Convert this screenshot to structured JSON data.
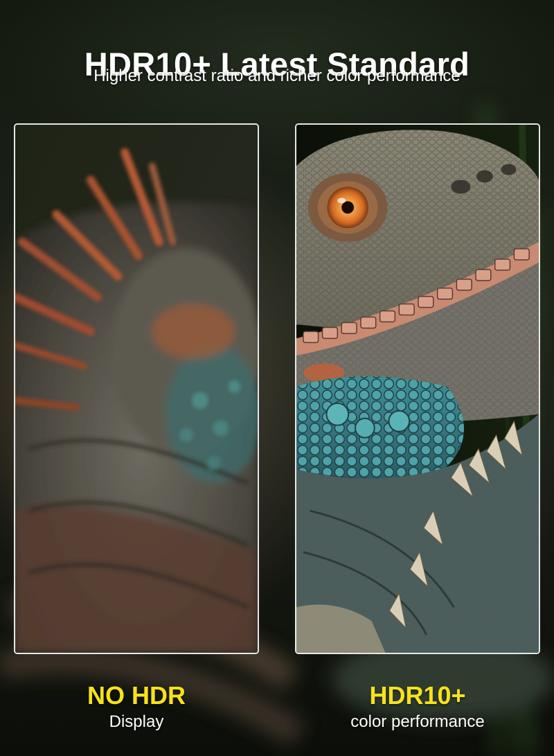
{
  "header": {
    "title": "HDR10+ Latest Standard",
    "subtitle": "Higher contrast ratio and richer color performance"
  },
  "comparison": {
    "left": {
      "label": "NO HDR",
      "sublabel": "Display"
    },
    "right": {
      "label": "HDR10+",
      "sublabel": "color performance"
    }
  },
  "colors": {
    "accent_yellow": "#f7e21a",
    "text_white": "#ffffff",
    "panel_border": "#e8e8e8",
    "scale_teal": "#4fa3a8",
    "eye_orange": "#e07a2a"
  }
}
